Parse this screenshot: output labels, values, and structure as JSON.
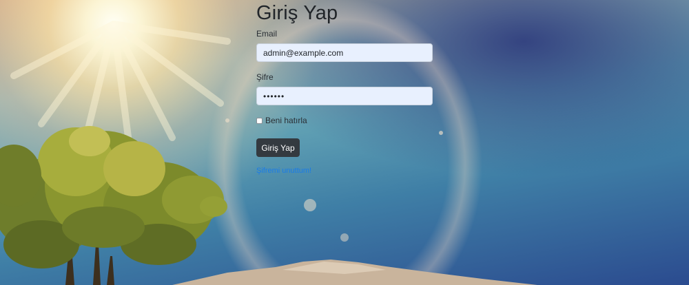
{
  "login": {
    "title": "Giriş Yap",
    "email_label": "Email",
    "email_value": "admin@example.com",
    "password_label": "Şifre",
    "password_value": "••••••",
    "remember_label": "Beni hatırla",
    "remember_checked": false,
    "submit_label": "Giriş Yap",
    "forgot_link": "Şifremi unuttum!"
  },
  "colors": {
    "button_bg": "#343a40",
    "input_bg": "#e8f0fe",
    "link": "#1a7be8"
  }
}
